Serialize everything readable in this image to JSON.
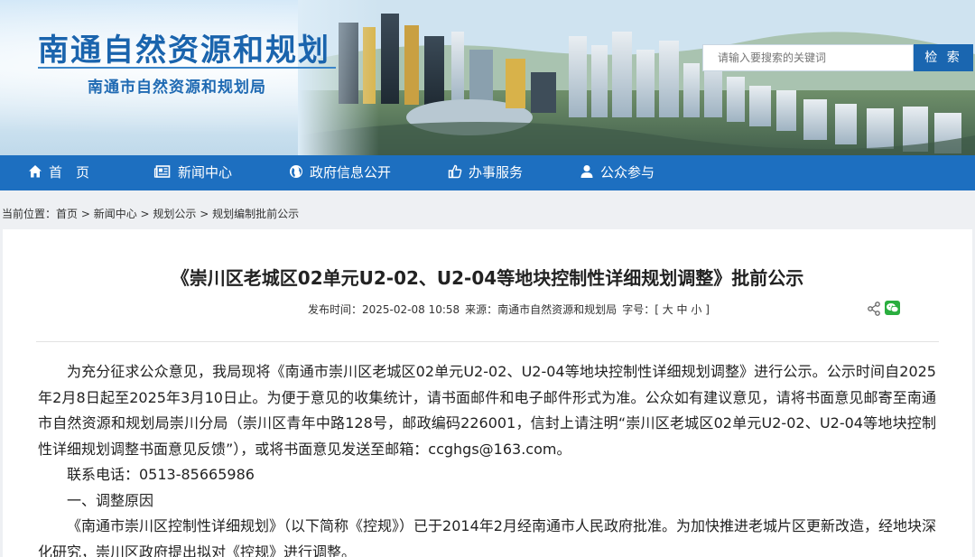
{
  "header": {
    "site_title": "南通自然资源和规划",
    "site_subtitle": "南通市自然资源和规划局",
    "search_placeholder": "请输入要搜索的关键词",
    "search_button": "检 索"
  },
  "nav": {
    "items": [
      {
        "label": "首　页",
        "icon": "home-icon"
      },
      {
        "label": "新闻中心",
        "icon": "newspaper-icon"
      },
      {
        "label": "政府信息公开",
        "icon": "globe-icon"
      },
      {
        "label": "办事服务",
        "icon": "thumbs-up-icon"
      },
      {
        "label": "公众参与",
        "icon": "user-icon"
      }
    ]
  },
  "breadcrumb": {
    "prefix": "当前位置：",
    "items": [
      "首页",
      "新闻中心",
      "规划公示",
      "规划编制批前公示"
    ],
    "separator": " > "
  },
  "article": {
    "title": "《崇川区老城区02单元U2-02、U2-04等地块控制性详细规划调整》批前公示",
    "publish_label": "发布时间：",
    "publish_time": "2025-02-08 10:58",
    "source_label": "来源：",
    "source": "南通市自然资源和规划局",
    "font_size_label": "字号：",
    "font_sizes": [
      "大",
      "中",
      "小"
    ],
    "paragraphs": [
      "为充分征求公众意见，我局现将《南通市崇川区老城区02单元U2-02、U2-04等地块控制性详细规划调整》进行公示。公示时间自2025年2月8日起至2025年3月10日止。为便于意见的收集统计，请书面邮件和电子邮件形式为准。公众如有建议意见，请将书面意见邮寄至南通市自然资源和规划局崇川分局（崇川区青年中路128号，邮政编码226001，信封上请注明“崇川区老城区02单元U2-02、U2-04等地块控制性详细规划调整书面意见反馈”），或将书面意见发送至邮箱：ccghgs@163.com。",
      "联系电话：0513-85665986",
      "一、调整原因",
      "《南通市崇川区控制性详细规划》（以下简称《控规》）已于2014年2月经南通市人民政府批准。为加快推进老城片区更新改造，经地块深化研究，崇川区政府提出拟对《控规》进行调整。"
    ]
  },
  "colors": {
    "nav_blue": "#1d6fc0",
    "logo_blue": "#1a64ad",
    "search_button_blue": "#1a66b0",
    "wechat_green": "#2aae3f"
  }
}
